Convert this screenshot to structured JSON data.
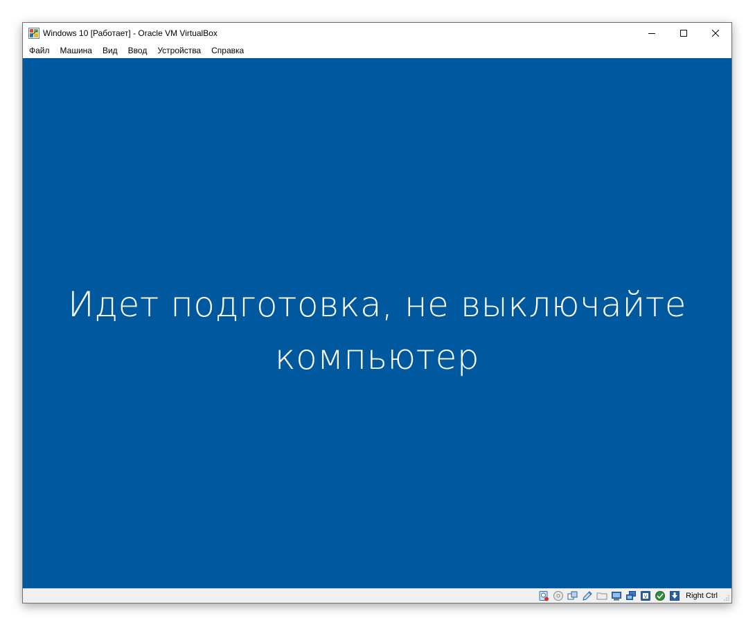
{
  "window": {
    "title": "Windows 10 [Работает] - Oracle VM VirtualBox",
    "controls": [
      "minimize-icon",
      "maximize-icon",
      "close-icon"
    ]
  },
  "menu": {
    "items": [
      "Файл",
      "Машина",
      "Вид",
      "Ввод",
      "Устройства",
      "Справка"
    ]
  },
  "vm": {
    "background_color": "#00599e",
    "message_line1": "Идет подготовка, не выключайте",
    "message_line2": "компьютер"
  },
  "statusbar": {
    "icons": [
      "hard-disk-icon",
      "optical-drive-icon",
      "audio-icon",
      "network-icon",
      "usb-icon",
      "shared-folders-icon",
      "display-icon",
      "video-capture-icon",
      "cpu-virtualization-icon",
      "mouse-integration-icon",
      "keyboard-capture-icon"
    ],
    "host_key": "Right Ctrl"
  }
}
